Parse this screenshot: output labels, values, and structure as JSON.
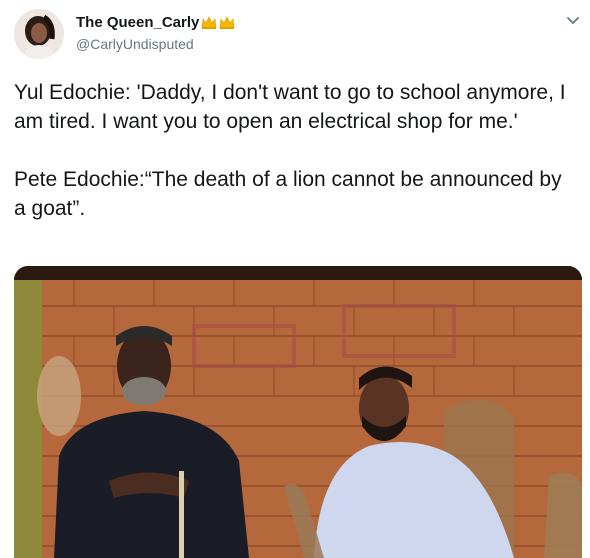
{
  "author": {
    "display_name": "The Queen_Carly",
    "badges": [
      "crown-icon",
      "crown-icon"
    ],
    "handle": "@CarlyUndisputed"
  },
  "tweet": {
    "paragraphs": [
      "Yul Edochie: 'Daddy, I don't want to go to school anymore, I am tired. I want you to open an electrical shop for me.'",
      "Pete Edochie:“The death of a lion cannot be announced by a goat”."
    ]
  },
  "media": {
    "description_icon": "photo-two-men-seated-brick-wall"
  },
  "colors": {
    "text": "#14171a",
    "muted": "#657786",
    "crown": "#f5b800",
    "brick": "#b86a3c"
  }
}
